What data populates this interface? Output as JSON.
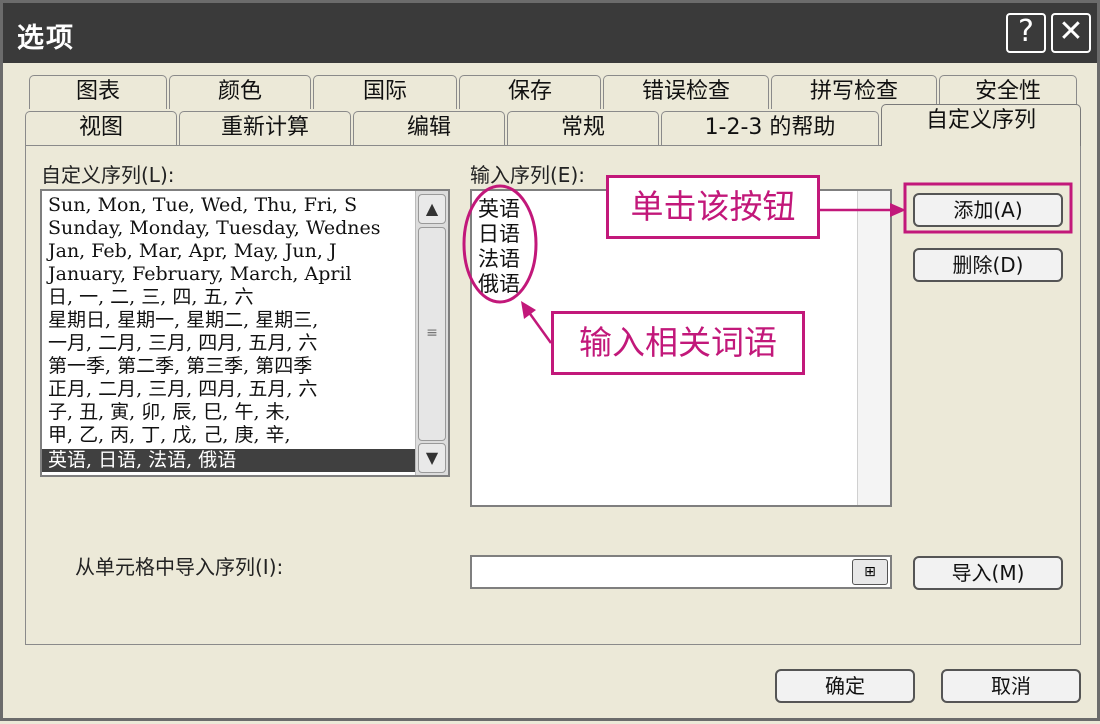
{
  "window": {
    "title": "选项",
    "help_glyph": "?",
    "close_glyph": "✕"
  },
  "tabs": {
    "row1": [
      "图表",
      "颜色",
      "国际",
      "保存",
      "错误检查",
      "拼写检查",
      "安全性"
    ],
    "row2": [
      "视图",
      "重新计算",
      "编辑",
      "常规",
      "1-2-3 的帮助",
      "自定义序列"
    ],
    "active": "自定义序列"
  },
  "custom_lists": {
    "label": "自定义序列(L):",
    "items": [
      "Sun, Mon, Tue, Wed, Thu, Fri, S",
      "Sunday, Monday, Tuesday, Wednes",
      "Jan, Feb, Mar, Apr, May, Jun, J",
      "January, February, March, April",
      "日, 一, 二, 三, 四, 五, 六",
      "星期日, 星期一, 星期二, 星期三,",
      "一月, 二月, 三月, 四月, 五月, 六",
      "第一季, 第二季, 第三季, 第四季",
      "正月, 二月, 三月, 四月, 五月, 六",
      "子, 丑, 寅, 卯, 辰, 巳, 午, 未,",
      "甲, 乙, 丙, 丁, 戊, 己, 庚, 辛,",
      "英语, 日语, 法语, 俄语"
    ],
    "selected_index": 11,
    "scroll_up": "▲",
    "scroll_down": "▼",
    "thumb_grip": "≡"
  },
  "entries": {
    "label": "输入序列(E):",
    "lines": [
      "英语",
      "日语",
      "法语",
      "俄语"
    ]
  },
  "buttons": {
    "add": "添加(A)",
    "delete": "删除(D)",
    "import": "导入(M)",
    "ok": "确定",
    "cancel": "取消",
    "range_glyph": "⊞"
  },
  "import": {
    "label": "从单元格中导入序列(I):",
    "value": ""
  },
  "annotations": {
    "click_button": "单击该按钮",
    "enter_words": "输入相关词语"
  },
  "colors": {
    "annotation": "#c2187a",
    "titlebar": "#3a3a3a",
    "selection": "#404040"
  }
}
